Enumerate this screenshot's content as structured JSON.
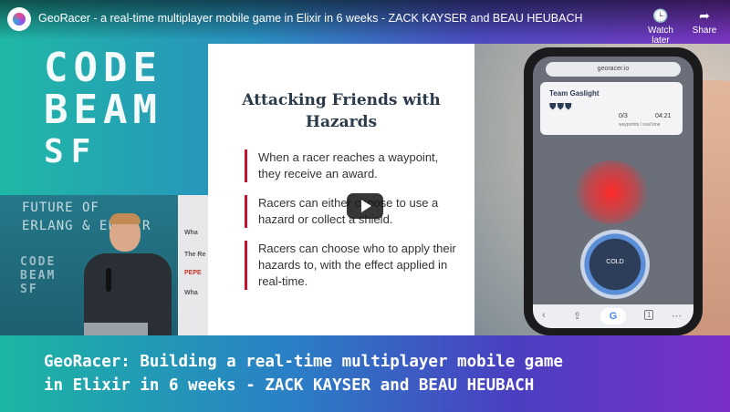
{
  "header": {
    "title": "GeoRacer - a real-time multiplayer mobile game in Elixir in 6 weeks - ZACK KAYSER and BEAU HEUBACH",
    "watch_later_label": "Watch later",
    "share_label": "Share",
    "icons": {
      "watch_later": "clock-icon",
      "share": "share-arrow-icon",
      "play": "play-icon"
    }
  },
  "logo": {
    "line1": "CODE",
    "line2": "BEAM",
    "line3": "SF"
  },
  "speaker_video": {
    "banner_lines": [
      "FUTURE OF",
      "ERLANG & ELIXIR"
    ],
    "banner_logo": [
      "CODE",
      "BEAM",
      "SF"
    ],
    "sponsors": [
      "Wha",
      "The Re",
      "PEPE",
      "Wha"
    ]
  },
  "slide": {
    "title": "Attacking Friends with Hazards",
    "bullets": [
      "When a racer reaches a waypoint, they receive an award.",
      "Racers can either choose to use a hazard or collect a shield.",
      "Racers can choose who to apply their hazards to, with the effect applied in real-time."
    ]
  },
  "phone": {
    "url": "georacer.io",
    "team_name": "Team Gaslight",
    "waypoints": "0/3",
    "waypoints_sub": "waypoints / real time",
    "timer": "04:21",
    "gauge_label": "COLD",
    "nav_g": "G",
    "nav_tabs": "1"
  },
  "caption": {
    "line1": "GeoRacer: Building a real-time multiplayer mobile game",
    "line2": "in Elixir in 6 weeks - ZACK KAYSER and BEAU HEUBACH"
  }
}
